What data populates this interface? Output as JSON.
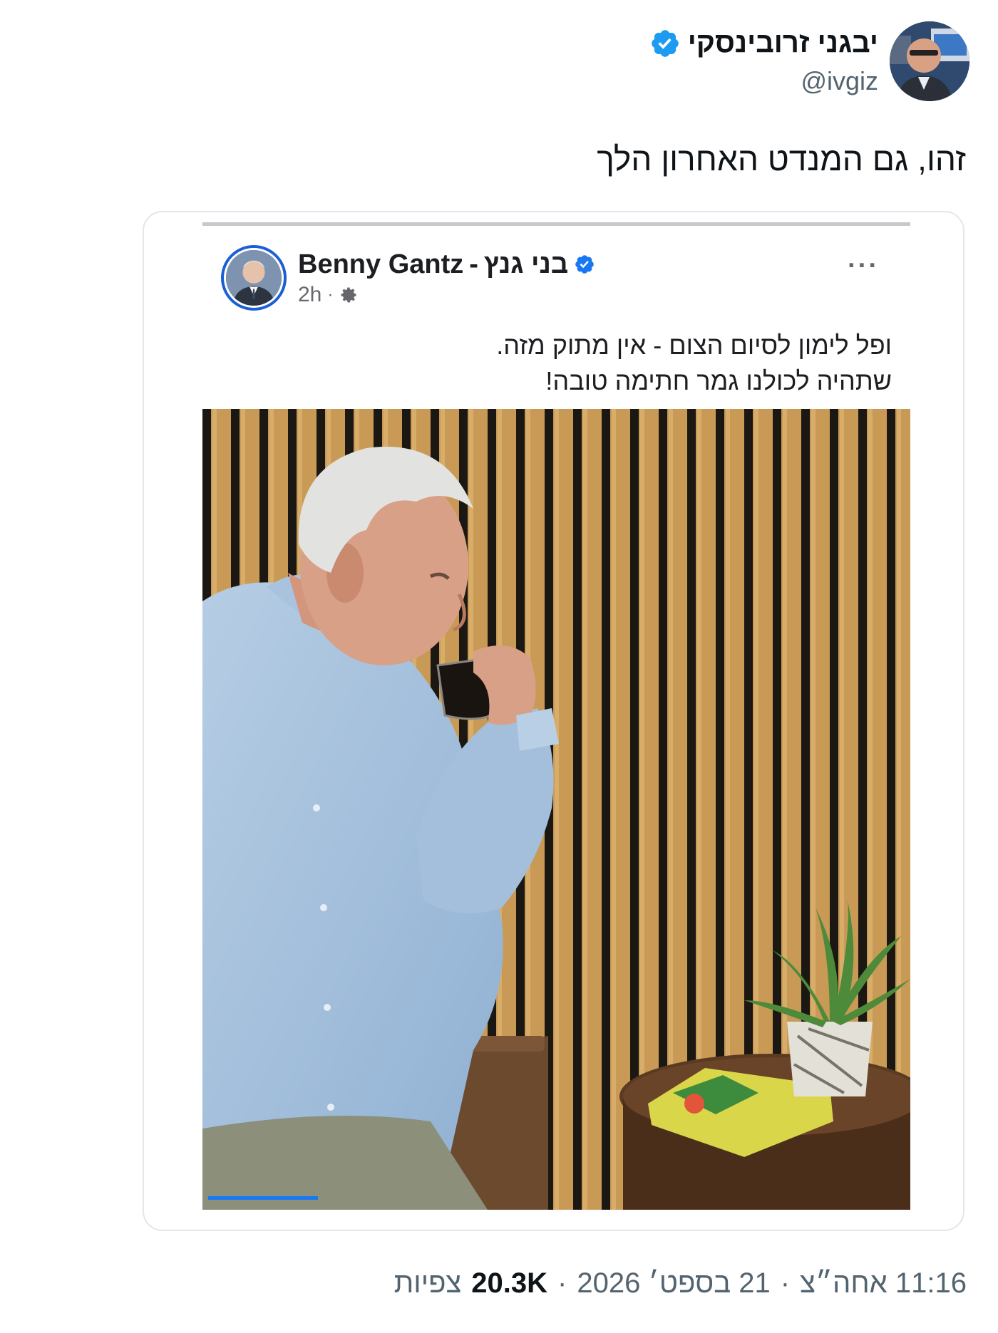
{
  "tweet": {
    "author_name": "יבגני זרובינסקי",
    "handle": "@ivgiz",
    "text": "זהו, גם המנדט האחרון הלך",
    "verified_color": "#1d9bf0"
  },
  "embedded_post": {
    "author_name_en": "Benny Gantz",
    "separator": "-",
    "author_name_he": "בני גנץ",
    "time": "2h",
    "dot": "·",
    "more_label": "···",
    "text_line_1": "ופל לימון לסיום הצום - אין מתוק מזה.",
    "text_line_2": "שתהיה לכולנו גמר חתימה טובה!",
    "verified_color": "#1877f2"
  },
  "footer": {
    "time": "11:16 אחה״צ",
    "dot_1": "·",
    "date": "21 בספט׳ 2026",
    "dot_2": "·",
    "views_count": "20.3K",
    "views_label": "צפיות"
  }
}
